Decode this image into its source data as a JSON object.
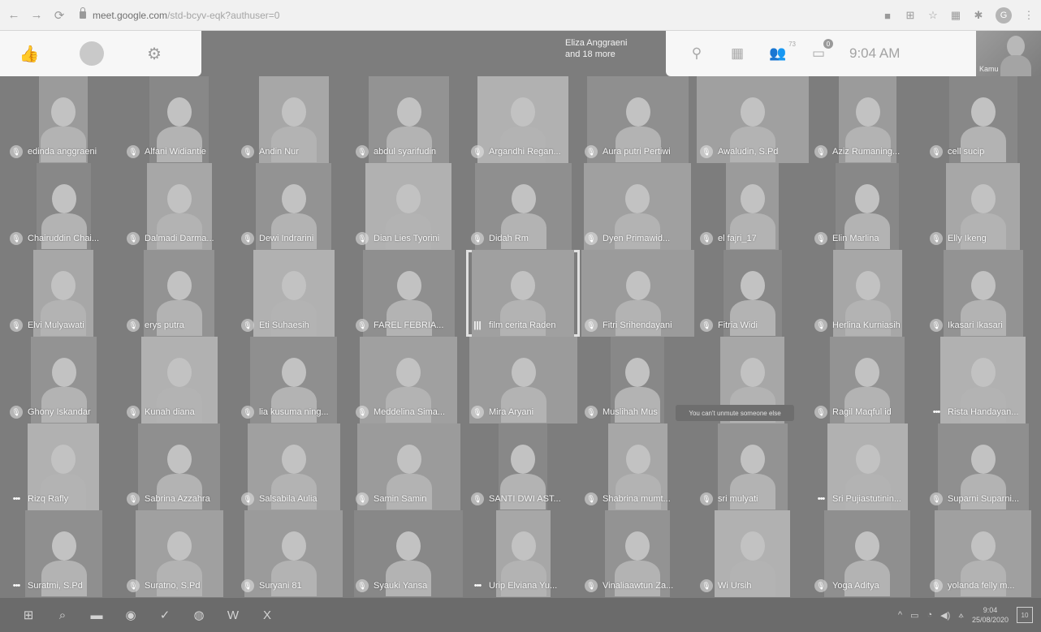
{
  "browser": {
    "url_host": "meet.google.com",
    "url_path": "/std-bcyv-eqk?authuser=0",
    "profile_initial": "G"
  },
  "meet": {
    "presenter_line1": "Eliza Anggraeni",
    "presenter_line2": "and 18 more",
    "participants_badge": "73",
    "chat_badge": "0",
    "clock": "9:04 AM",
    "self_label": "Kamu",
    "tooltip": "You can't unmute someone else"
  },
  "participants": [
    [
      "edinda anggraeni",
      "Alfani Widiantie",
      "Andin Nur",
      "abdul syarifudin",
      "Argandhi Regan...",
      "Aura putri Pertiwi",
      "Awaludin, S.Pd",
      "Aziz Rumaning...",
      "cell sucip"
    ],
    [
      "Chairuddin Chai...",
      "Dalmadi Darma...",
      "Dewi Indrarini",
      "Dian Lies Tyorini",
      "Didah Rm",
      "Dyen Primawid...",
      "el fajri_17",
      "Elin Marlina",
      "Elly Ikeng"
    ],
    [
      "Elvi Mulyawati",
      "erys putra",
      "Eti Suhaesih",
      "FAREL FEBRIA...",
      "film cerita Raden",
      "Fitri Srihendayani",
      "Fitria Widi",
      "Herlina Kurniasih",
      "Ikasari Ikasari"
    ],
    [
      "Ghony Iskandar",
      "Kunah diana",
      "lia kusuma ning...",
      "Meddelina Sima...",
      "Mira Aryani",
      "Muslihah Mus",
      "",
      "Ragil Maqful id",
      "Rista Handayan..."
    ],
    [
      "Rizq Rafly",
      "Sabrina Azzahra",
      "Salsabila Aulia",
      "Samin Samin",
      "SANTI DWI AST...",
      "Shabrina mumt...",
      "sri mulyati",
      "Sri Pujiastutinin...",
      "Suparni Suparni..."
    ],
    [
      "Suratmi, S.Pd",
      "Suratno, S.Pd",
      "Suryani 81",
      "Syauki Yansa",
      "Urip Elviana Yu...",
      "Vinaliaawtun Za...",
      "Wi Ursih",
      "Yoga Aditya",
      "yolanda felly m..."
    ]
  ],
  "icons": {
    "mic_off": "🎙",
    "dots": "•••",
    "speaking": "|||"
  },
  "taskbar": {
    "tray_time": "9:04",
    "tray_date": "25/08/2020",
    "notif_count": "10"
  }
}
